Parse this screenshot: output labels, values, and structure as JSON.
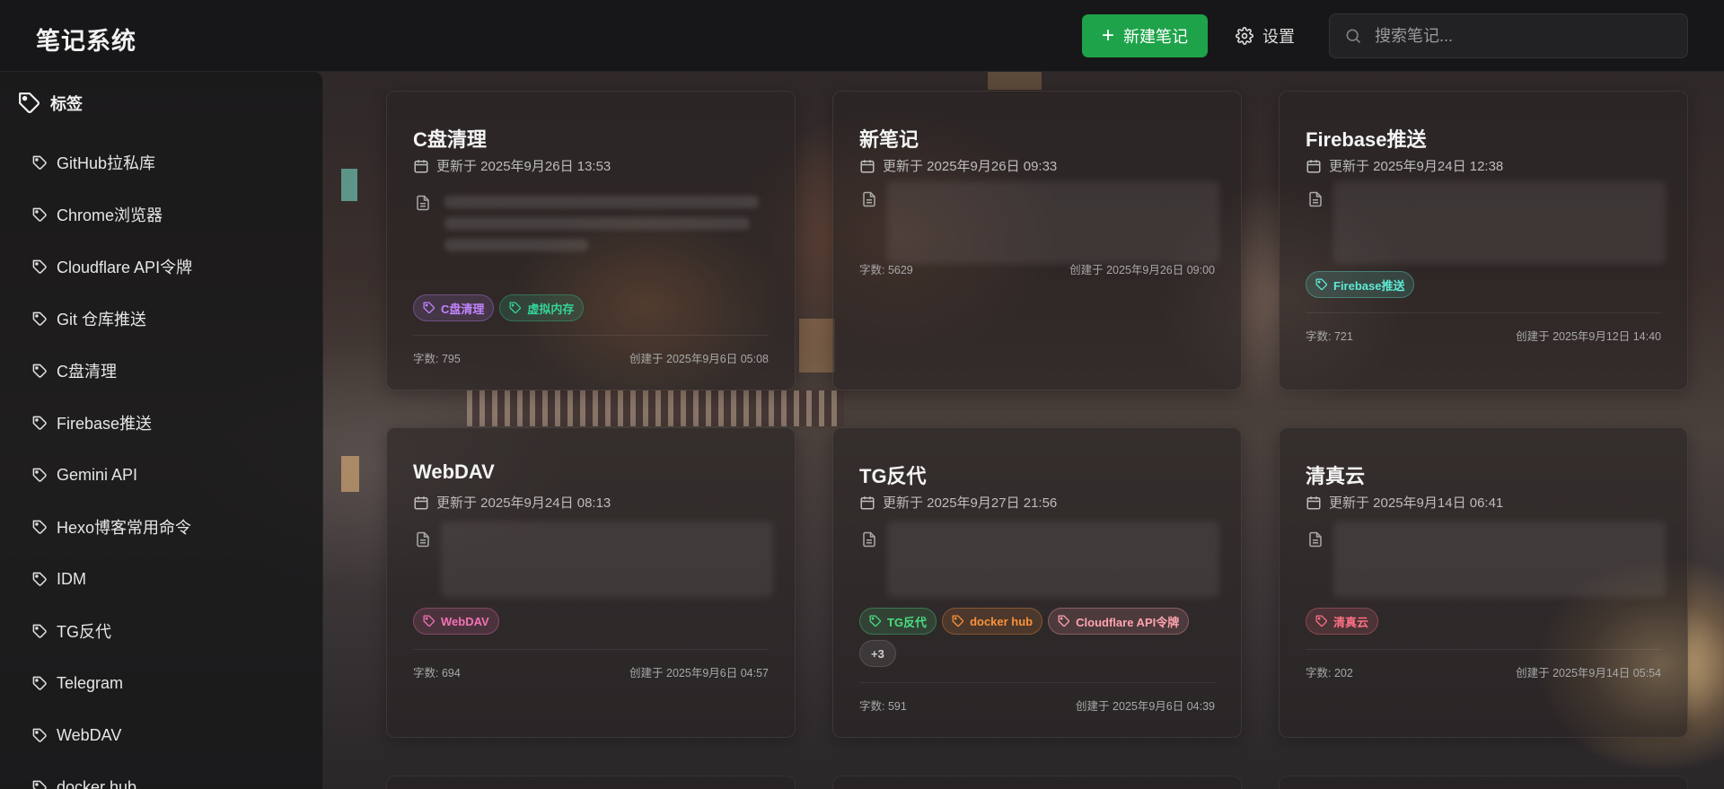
{
  "header": {
    "title": "笔记系统",
    "new_note_label": "新建笔记",
    "settings_label": "设置",
    "search_placeholder": "搜索笔记..."
  },
  "sidebar": {
    "heading": "标签",
    "tags": [
      "GitHub拉私库",
      "Chrome浏览器",
      "Cloudflare API令牌",
      "Git 仓库推送",
      "C盘清理",
      "Firebase推送",
      "Gemini API",
      "Hexo博客常用命令",
      "IDM",
      "TG反代",
      "Telegram",
      "WebDAV",
      "docker hub"
    ]
  },
  "notes": [
    {
      "title": "C盘清理",
      "updated": "更新于 2025年9月26日 13:53",
      "tags": [
        {
          "label": "C盘清理",
          "color": "#c084fc"
        },
        {
          "label": "虚拟内存",
          "color": "#34d399"
        }
      ],
      "word_count": "字数: 795",
      "created": "创建于 2025年9月6日 05:08"
    },
    {
      "title": "新笔记",
      "updated": "更新于 2025年9月26日 09:33",
      "tags": [],
      "word_count": "字数: 5629",
      "created": "创建于 2025年9月26日 09:00"
    },
    {
      "title": "Firebase推送",
      "updated": "更新于 2025年9月24日 12:38",
      "tags": [
        {
          "label": "Firebase推送",
          "color": "#5eead4"
        }
      ],
      "word_count": "字数: 721",
      "created": "创建于 2025年9月12日 14:40"
    },
    {
      "title": "WebDAV",
      "updated": "更新于 2025年9月24日 08:13",
      "tags": [
        {
          "label": "WebDAV",
          "color": "#f472b6"
        }
      ],
      "word_count": "字数: 694",
      "created": "创建于 2025年9月6日 04:57"
    },
    {
      "title": "TG反代",
      "updated": "更新于 2025年9月27日 21:56",
      "tags": [
        {
          "label": "TG反代",
          "color": "#4ade80"
        },
        {
          "label": "docker hub",
          "color": "#fb923c"
        },
        {
          "label": "Cloudflare API令牌",
          "color": "#fda4af"
        }
      ],
      "more_tags": "+3",
      "word_count": "字数: 591",
      "created": "创建于 2025年9月6日 04:39"
    },
    {
      "title": "清真云",
      "updated": "更新于 2025年9月14日 06:41",
      "tags": [
        {
          "label": "清真云",
          "color": "#fb7185"
        }
      ],
      "word_count": "字数: 202",
      "created": "创建于 2025年9月14日 05:54"
    }
  ]
}
